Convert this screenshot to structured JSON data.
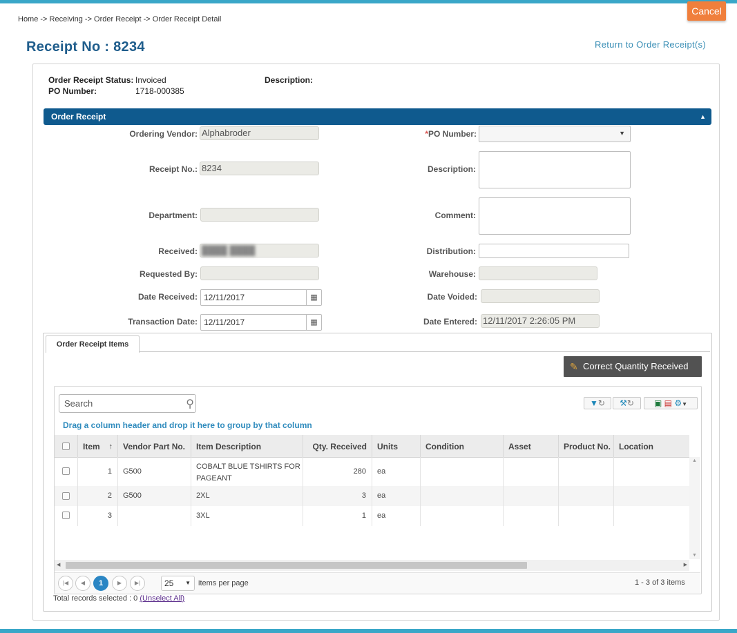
{
  "header": {
    "cancel_label": "Cancel",
    "breadcrumb": "Home -> Receiving -> Order Receipt -> Order Receipt Detail",
    "title": "Receipt No : 8234",
    "return_link": "Return to Order Receipt(s)"
  },
  "summary": {
    "status_label": "Order Receipt Status:",
    "status_value": "Invoiced",
    "po_label": "PO Number:",
    "po_value": "1718-000385",
    "description_label": "Description:"
  },
  "section": {
    "title": "Order Receipt"
  },
  "form": {
    "ordering_vendor_label": "Ordering Vendor:",
    "ordering_vendor_value": "Alphabroder",
    "po_number_label": "*PO Number:",
    "po_number_value": "",
    "receipt_no_label": "Receipt No.:",
    "receipt_no_value": "8234",
    "description_label": "Description:",
    "description_value": "",
    "department_label": "Department:",
    "department_value": "",
    "comment_label": "Comment:",
    "comment_value": "",
    "received_label": "Received:",
    "received_value": "████ ████",
    "distribution_label": "Distribution:",
    "distribution_value": "",
    "requested_by_label": "Requested By:",
    "requested_by_value": "",
    "warehouse_label": "Warehouse:",
    "warehouse_value": "",
    "date_received_label": "Date Received:",
    "date_received_value": "12/11/2017",
    "date_voided_label": "Date Voided:",
    "date_voided_value": "",
    "transaction_date_label": "Transaction Date:",
    "transaction_date_value": "12/11/2017",
    "date_entered_label": "Date Entered:",
    "date_entered_value": "12/11/2017 2:26:05 PM"
  },
  "items": {
    "tab_label": "Order Receipt Items",
    "correct_qty_label": "Correct Quantity Received",
    "search_placeholder": "Search",
    "group_hint": "Drag a column header and drop it here to group by that column",
    "columns": {
      "item": "Item",
      "vendor_part": "Vendor Part No.",
      "description": "Item Description",
      "qty": "Qty. Received",
      "units": "Units",
      "condition": "Condition",
      "asset": "Asset",
      "product_no": "Product No.",
      "location": "Location"
    },
    "rows": [
      {
        "item": "1",
        "vendor_part": "G500",
        "description_line1": "COBALT BLUE TSHIRTS FOR",
        "description_line2": "PAGEANT",
        "qty": "280",
        "units": "ea"
      },
      {
        "item": "2",
        "vendor_part": "G500",
        "description": "2XL",
        "qty": "3",
        "units": "ea"
      },
      {
        "item": "3",
        "vendor_part": "",
        "description": "3XL",
        "qty": "1",
        "units": "ea"
      }
    ],
    "pager": {
      "current_page": "1",
      "page_size": "25",
      "items_per_page": "items per page",
      "range": "1 - 3 of 3 items"
    },
    "selection_text": "Total records selected : 0 ",
    "unselect_all": "(Unselect All)"
  },
  "colors": {
    "accent": "#3aa7c8",
    "header_blue": "#0f5a8e",
    "title_blue": "#1f5d8c",
    "cancel_orange": "#f07f3c",
    "page_active": "#2b86c4"
  }
}
